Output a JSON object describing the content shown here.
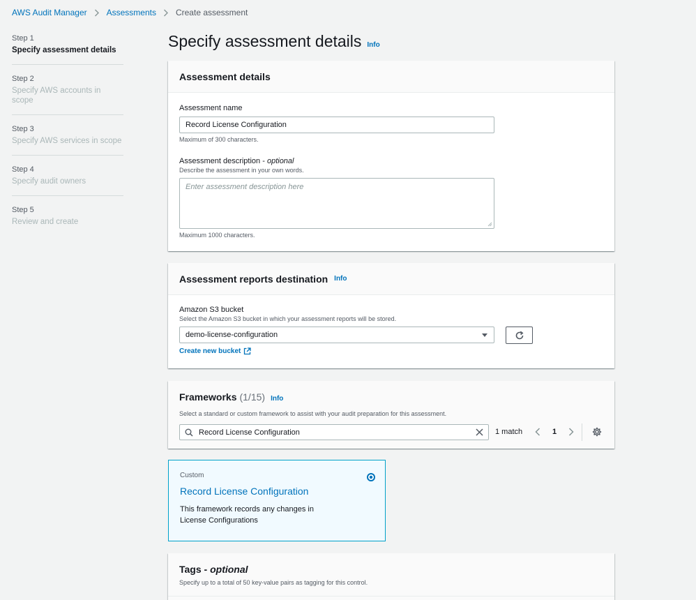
{
  "breadcrumb": {
    "items": [
      "AWS Audit Manager",
      "Assessments"
    ],
    "current": "Create assessment"
  },
  "steps": [
    {
      "num": "Step 1",
      "label": "Specify assessment details"
    },
    {
      "num": "Step 2",
      "label": "Specify AWS accounts in scope"
    },
    {
      "num": "Step 3",
      "label": "Specify AWS services in scope"
    },
    {
      "num": "Step 4",
      "label": "Specify audit owners"
    },
    {
      "num": "Step 5",
      "label": "Review and create"
    }
  ],
  "page": {
    "title": "Specify assessment details",
    "info": "Info"
  },
  "details": {
    "title": "Assessment details",
    "name_label": "Assessment name",
    "name_value": "Record License Configuration",
    "name_constraint": "Maximum of 300 characters.",
    "desc_label": "Assessment description -",
    "desc_optional": "optional",
    "desc_help": "Describe the assessment in your own words.",
    "desc_placeholder": "Enter assessment description here",
    "desc_constraint": "Maximum 1000 characters."
  },
  "reports": {
    "title": "Assessment reports destination",
    "info": "Info",
    "bucket_label": "Amazon S3 bucket",
    "bucket_help": "Select the Amazon S3 bucket in which your assessment reports will be stored.",
    "bucket_value": "demo-license-configuration",
    "create_link": "Create new bucket"
  },
  "frameworks": {
    "title": "Frameworks",
    "count": "(1/15)",
    "info": "Info",
    "description": "Select a standard or custom framework to assist with your audit preparation for this assessment.",
    "search_value": "Record License Configuration",
    "match_text": "1 match",
    "page_number": "1"
  },
  "card": {
    "type": "Custom",
    "title": "Record License Configuration",
    "desc_line1": "This framework records any changes in",
    "desc_line2": "License Configurations",
    "selected": true
  },
  "tags": {
    "title": "Tags -",
    "optional": "optional",
    "description": "Specify up to a total of 50 key-value pairs as tagging for this control."
  },
  "colors": {
    "link": "#0073bb",
    "selected_border": "#00a1c9",
    "selected_bg": "#f1faff"
  }
}
